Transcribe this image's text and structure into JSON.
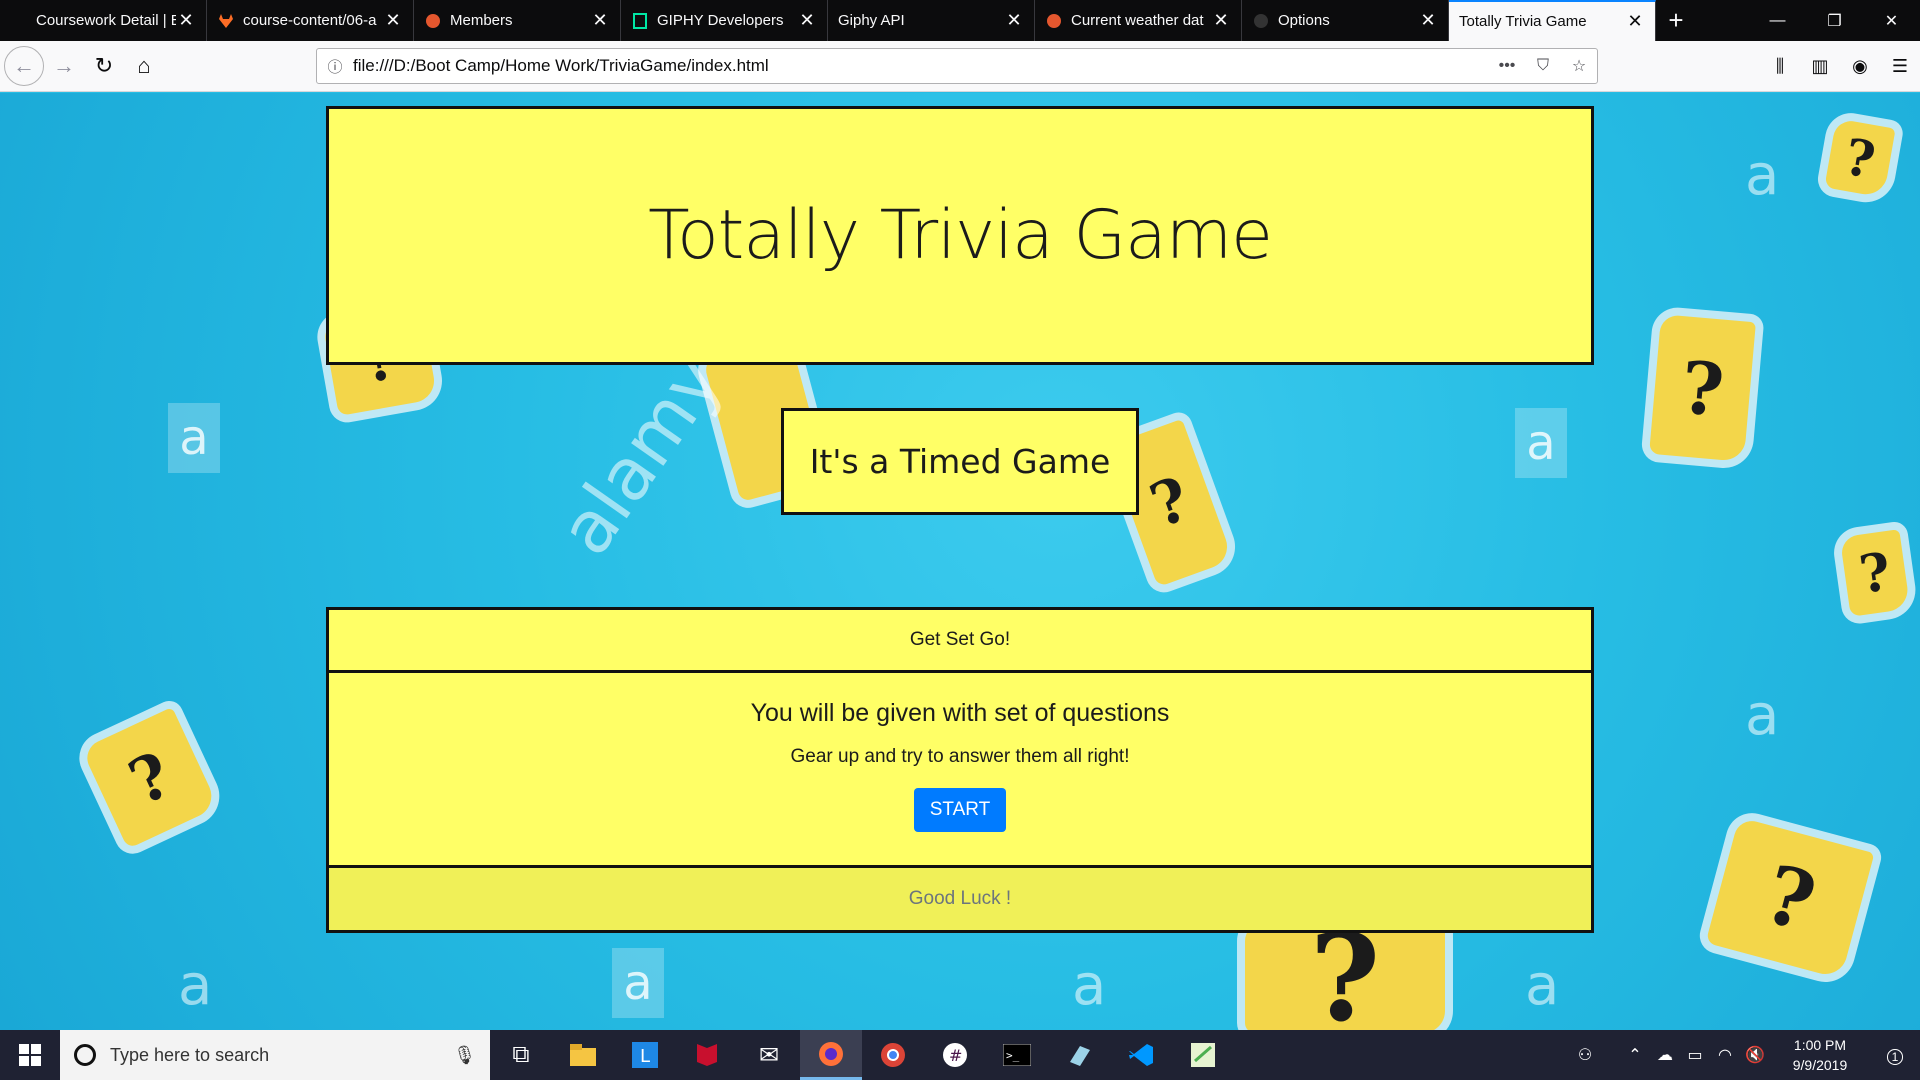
{
  "browser": {
    "tabs": [
      {
        "title": "Coursework Detail | Boo",
        "icon": "bootcamp-icon"
      },
      {
        "title": "course-content/06-a",
        "icon": "gitlab-icon"
      },
      {
        "title": "Members",
        "icon": "weather-icon"
      },
      {
        "title": "GIPHY Developers",
        "icon": "document-icon"
      },
      {
        "title": "Giphy API",
        "icon": ""
      },
      {
        "title": "Current weather dat",
        "icon": "weather-icon"
      },
      {
        "title": "Options",
        "icon": "github-icon"
      },
      {
        "title": "Totally Trivia Game",
        "icon": "",
        "active": true
      }
    ],
    "url": "file:///D:/Boot Camp/Home Work/TriviaGame/index.html"
  },
  "page": {
    "title": "Totally Trivia Game",
    "subtitle": "It's a Timed Game",
    "card": {
      "header": "Get Set Go!",
      "body_title": "You will be given with set of questions",
      "body_text": "Gear up and try to answer them all right!",
      "start_label": "START",
      "footer": "Good Luck !"
    },
    "background": {
      "watermark_text": "alamy",
      "watermark_letter": "a",
      "question_mark": "?"
    },
    "colors": {
      "panel": "#ffff66",
      "background": "#27bde4",
      "button": "#007bff"
    }
  },
  "taskbar": {
    "search_placeholder": "Type here to search",
    "time": "1:00 PM",
    "date": "9/9/2019",
    "notification_count": "1"
  }
}
